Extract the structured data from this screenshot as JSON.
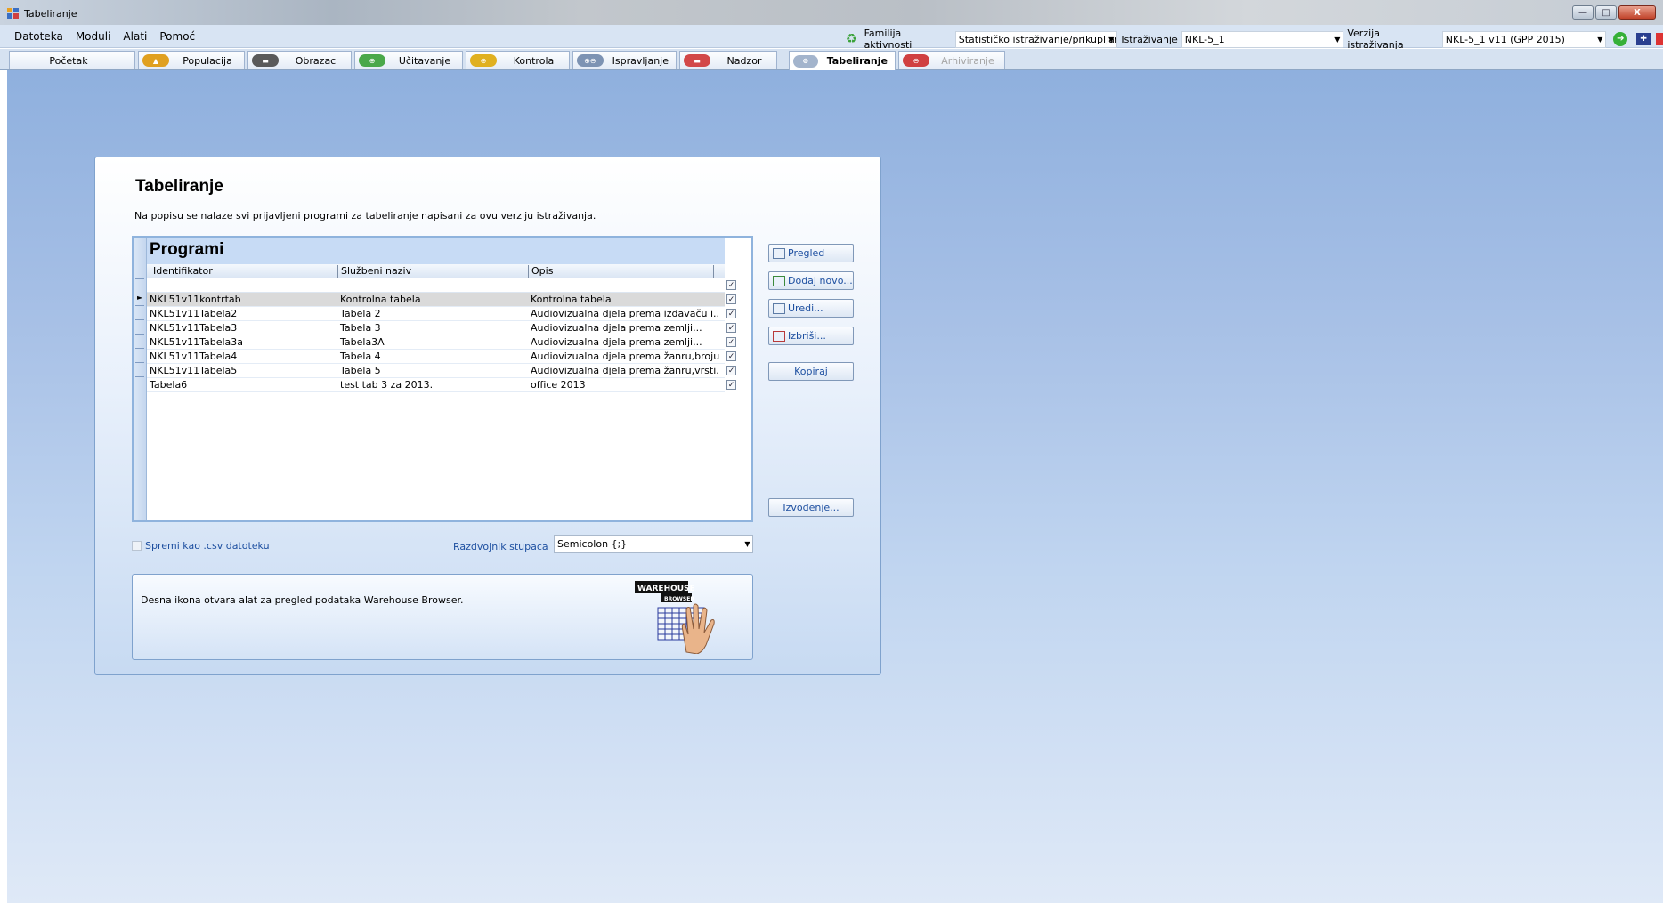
{
  "window": {
    "title": "Tabeliranje",
    "minimize": "—",
    "maximize": "□",
    "close": "X"
  },
  "menu": [
    "Datoteka",
    "Moduli",
    "Alati",
    "Pomoć"
  ],
  "toolbar": {
    "familija_label": "Familija aktivnosti",
    "familija_value": "Statističko istraživanje/prikupljan",
    "istrazivanje_label": "Istraživanje",
    "istrazivanje_value": "NKL-5_1",
    "verzija_label": "Verzija istraživanja",
    "verzija_value": "NKL-5_1 v11 (GPP 2015)"
  },
  "tabs": [
    {
      "label": "Početak",
      "icon": "none"
    },
    {
      "label": "Populacija",
      "icon": "population-icon",
      "color": "#e0a020"
    },
    {
      "label": "Obrazac",
      "icon": "form-icon",
      "color": "#5a5a5a"
    },
    {
      "label": "Učitavanje",
      "icon": "load-icon",
      "color": "#4aa84a"
    },
    {
      "label": "Kontrola",
      "icon": "control-icon",
      "color": "#e0b020"
    },
    {
      "label": "Ispravljanje",
      "icon": "edit-icon",
      "color": "#7d93b3"
    },
    {
      "label": "Nadzor",
      "icon": "monitor-icon",
      "color": "#d24848"
    },
    {
      "label": "Tabeliranje",
      "icon": "table-icon",
      "color": "#a3b4cc"
    },
    {
      "label": "Arhiviranje",
      "icon": "archive-icon",
      "color": "#d04040"
    }
  ],
  "panel": {
    "title": "Tabeliranje",
    "description": "Na popisu se nalaze svi prijavljeni programi za tabeliranje napisani za ovu verziju istraživanja.",
    "grid_caption": "Programi",
    "columns": [
      "Identifikator",
      "Službeni naziv",
      "Opis"
    ],
    "rows": [
      [
        "NKL51v11kontrtab",
        "Kontrolna tabela",
        "Kontrolna tabela"
      ],
      [
        "NKL51v11Tabela2",
        "Tabela 2",
        "Audiovizualna djela prema izdavaču i..."
      ],
      [
        "NKL51v11Tabela3",
        "Tabela 3",
        "Audiovizualna djela prema zemlji..."
      ],
      [
        "NKL51v11Tabela3a",
        "Tabela3A",
        "Audiovizualna djela prema zemlji..."
      ],
      [
        "NKL51v11Tabela4",
        "Tabela 4",
        "Audiovizualna djela prema žanru,broju..."
      ],
      [
        "NKL51v11Tabela5",
        "Tabela 5",
        "Audiovizualna djela prema žanru,vrsti..."
      ],
      [
        "Tabela6",
        "test tab 3 za 2013.",
        "office 2013"
      ]
    ],
    "buttons": {
      "pregled": "Pregled",
      "dodaj": "Dodaj novo...",
      "uredi": "Uredi...",
      "izbrisi": "Izbriši...",
      "kopiraj": "Kopiraj",
      "izvodenje": "Izvođenje..."
    },
    "csv_label": "Spremi kao .csv datoteku",
    "separator_label": "Razdvojnik stupaca",
    "separator_value": "Semicolon  {;}",
    "warehouse_text": "Desna ikona otvara alat za pregled podataka Warehouse Browser.",
    "warehouse_logo_top": "WAREHOUSE",
    "warehouse_logo_bottom": "BROWSER"
  }
}
